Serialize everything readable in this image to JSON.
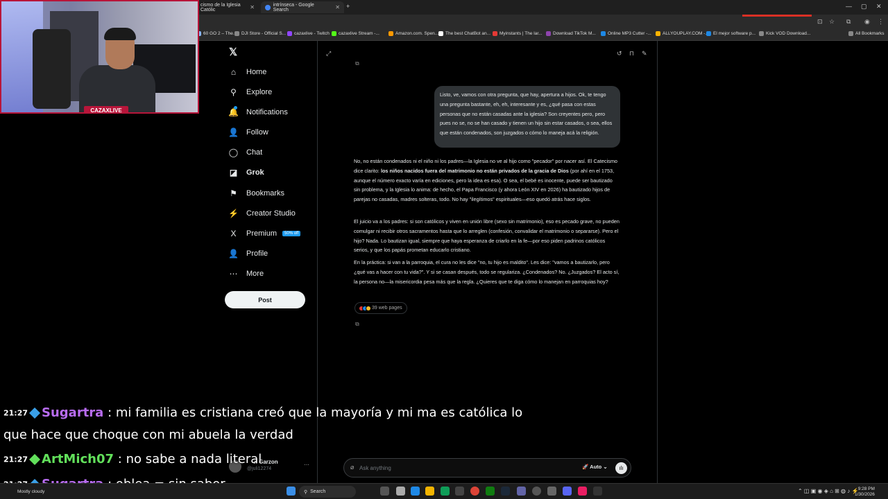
{
  "browser": {
    "tabs": [
      {
        "title": "cismo de la Iglesia Católic"
      },
      {
        "title": "intrínseca - Google Search"
      }
    ],
    "bookmarks": [
      {
        "label": "60 GO 2 – The...",
        "color": "#8ab4f8"
      },
      {
        "label": "DJI Store - Official S...",
        "color": "#888"
      },
      {
        "label": "cazaxlive - Twitch",
        "color": "#9146ff"
      },
      {
        "label": "cazaxlive Stream -...",
        "color": "#53fc18"
      },
      {
        "label": "Amazon.com. Spen...",
        "color": "#ff9900"
      },
      {
        "label": "The best ChatBot an...",
        "color": "#fff"
      },
      {
        "label": "Myinstants | The lar...",
        "color": "#e53935"
      },
      {
        "label": "Download TikTok M...",
        "color": "#8e44ad"
      },
      {
        "label": "Online MP3 Cutter -...",
        "color": "#1e88e5"
      },
      {
        "label": "ALLYOUPLAY.COM -...",
        "color": "#ffb300"
      },
      {
        "label": "El mejor software p...",
        "color": "#1e88e5"
      },
      {
        "label": "Kick VOD Download...",
        "color": "#888"
      }
    ],
    "all_bookmarks": "All Bookmarks"
  },
  "nav": {
    "items": [
      {
        "label": "Home",
        "icon": "home-icon",
        "glyph": "⌂"
      },
      {
        "label": "Explore",
        "icon": "search-icon",
        "glyph": "⚲"
      },
      {
        "label": "Notifications",
        "icon": "bell-icon",
        "glyph": "🔔"
      },
      {
        "label": "Follow",
        "icon": "follow-icon",
        "glyph": "👤"
      },
      {
        "label": "Chat",
        "icon": "chat-icon",
        "glyph": "◯"
      },
      {
        "label": "Grok",
        "icon": "grok-icon",
        "glyph": "◪"
      },
      {
        "label": "Bookmarks",
        "icon": "bookmark-icon",
        "glyph": "⚑"
      },
      {
        "label": "Creator Studio",
        "icon": "creator-studio-icon",
        "glyph": "⚡"
      },
      {
        "label": "Premium",
        "icon": "premium-icon",
        "glyph": "X"
      },
      {
        "label": "Profile",
        "icon": "profile-icon",
        "glyph": "👤"
      },
      {
        "label": "More",
        "icon": "more-icon",
        "glyph": "⋯"
      }
    ],
    "premium_badge": "50% off",
    "post_label": "Post",
    "profile_name": "n Garzon",
    "profile_handle": "@juli12274",
    "active": "Grok"
  },
  "conversation": {
    "user_message": "Listo, ve, vamos con otra pregunta, que hay, apertura a hijos. Ok, te tengo una pregunta bastante, eh, eh, interesante y es, ¿qué pasa con estas personas que no están casadas ante la iglesia? Son creyentes pero, pero pues no se, no se han casado y tienen un hijo sin estar casados, o sea, ellos que están condenados, son juzgados o cómo lo maneja acá la religión.",
    "p1_a": "No, no están condenados ni el niño ni los padres—la Iglesia no ve al hijo como \"pecador\" por nacer así. El Catecismo dice clarito: ",
    "p1_bold": "los niños nacidos fuera del matrimonio no están privados de la gracia de Dios",
    "p1_b": " (por ahí en el 1753, aunque el número exacto varía en ediciones, pero la idea es esa). O sea, el bebé es inocente, puede ser bautizado sin problema, y la Iglesia lo anima: de hecho, el Papa Francisco (y ahora León XIV en 2026) ha bautizado hijos de parejas no casadas, madres solteras, todo. No hay \"ilegítimos\" espirituales—eso quedó atrás hace siglos.",
    "p2": "El juicio va a los padres: si son católicos y viven en unión libre (sexo sin matrimonio), eso es pecado grave, no pueden comulgar ni recibir otros sacramentos hasta que lo arreglen (confesión, convalidar el matrimonio o separarse). Pero el hijo? Nada. Lo bautizan igual, siempre que haya esperanza de criarlo en la fe—por eso piden padrinos católicos serios, y que los papás prometan educarlo cristiano.",
    "p3": "En la práctica: si van a la parroquia, el cura no les dice \"no, tu hijo es maldito\". Les dice: \"vamos a bautizarlo, pero ¿qué vas a hacer con tu vida?\". Y si se casan después, todo se regulariza. ¿Condenados? No. ¿Juzgados? El acto sí, la persona no—la misericordia pesa más que la regla. ¿Quieres que te diga cómo lo manejan en parroquias hoy?",
    "web_pages": "39 web pages"
  },
  "ask": {
    "placeholder": "Ask anything",
    "mode": "Auto"
  },
  "webcam": {
    "name": "CAZAXLIVE"
  },
  "chat": [
    {
      "time": "21:27",
      "user": "Sugartra",
      "user_color": "#b86cf0",
      "icon_color": "#3aa0e8",
      "message": ": mi familia es cristiana creó que la mayoría y mi ma es católica lo",
      "cont": "que hace que choque con mi abuela la verdad"
    },
    {
      "time": "21:27",
      "user": "ArtMich07",
      "user_color": "#62e05b",
      "icon_color": "#62e05b",
      "message": ": no sabe a nada literal"
    },
    {
      "time": "21:27",
      "user": "Sugartra",
      "user_color": "#b86cf0",
      "icon_color": "#3aa0e8",
      "message": ": oblea = sin sabor"
    }
  ],
  "taskbar": {
    "search": "Search",
    "weather": "Mostly cloudy",
    "time": "9:28 PM",
    "date": "1/30/2026"
  }
}
